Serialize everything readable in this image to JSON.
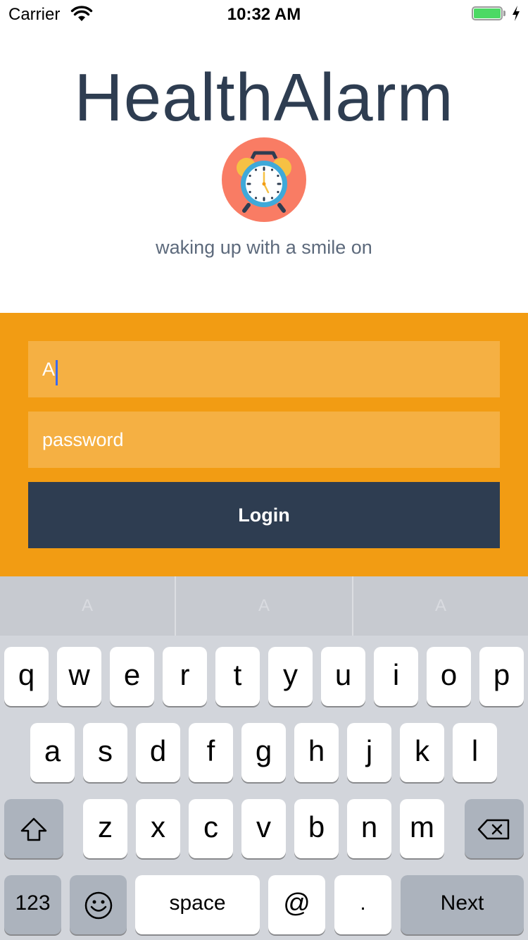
{
  "status_bar": {
    "carrier": "Carrier",
    "time": "10:32 AM",
    "battery_color": "#4cd964"
  },
  "header": {
    "title": "HealthAlarm",
    "logo_icon": "alarm-clock-icon",
    "tagline": "waking up with a smile on"
  },
  "form": {
    "username_value": "A",
    "password_placeholder": "password",
    "login_label": "Login",
    "panel_color": "#f29c13",
    "field_color": "#f5b043",
    "button_color": "#2e3d51"
  },
  "keyboard": {
    "predictions": [
      "A",
      "A",
      "A"
    ],
    "row1": [
      "q",
      "w",
      "e",
      "r",
      "t",
      "y",
      "u",
      "i",
      "o",
      "p"
    ],
    "row2": [
      "a",
      "s",
      "d",
      "f",
      "g",
      "h",
      "j",
      "k",
      "l"
    ],
    "row3": [
      "z",
      "x",
      "c",
      "v",
      "b",
      "n",
      "m"
    ],
    "shift_icon": "shift-arrow-icon",
    "delete_icon": "delete-backspace-icon",
    "numbers_label": "123",
    "emoji_icon": "emoji-smiley-icon",
    "space_label": "space",
    "at_label": "@",
    "dot_label": ".",
    "next_label": "Next"
  }
}
